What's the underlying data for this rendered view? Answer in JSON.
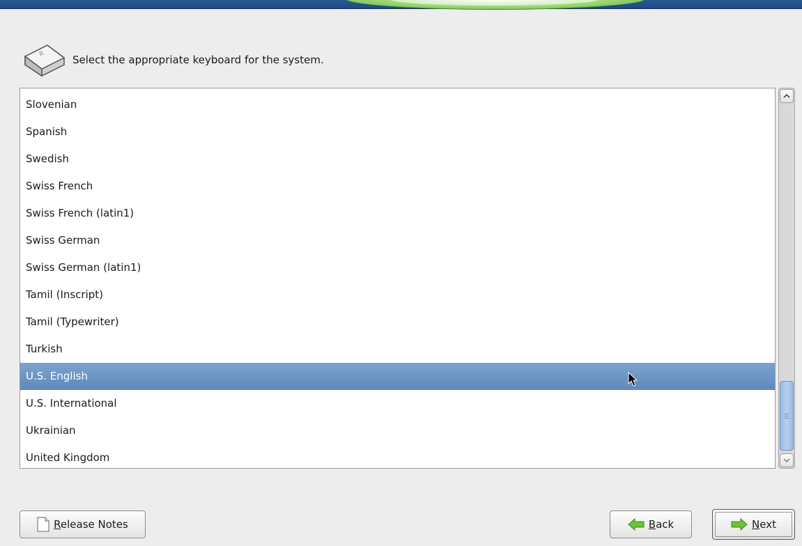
{
  "header": {
    "icon": "keyboard-key-icon",
    "prompt": "Select the appropriate keyboard for the system."
  },
  "keyboard_list": {
    "items": [
      "Slovenian",
      "Spanish",
      "Swedish",
      "Swiss French",
      "Swiss French (latin1)",
      "Swiss German",
      "Swiss German (latin1)",
      "Tamil (Inscript)",
      "Tamil (Typewriter)",
      "Turkish",
      "U.S. English",
      "U.S. International",
      "Ukrainian",
      "United Kingdom"
    ],
    "selected": "U.S. English",
    "selection_color": "#6a93c4"
  },
  "buttons": {
    "release_notes": {
      "label_first": "R",
      "label_rest": "elease Notes",
      "icon": "document-icon"
    },
    "back": {
      "label_first": "B",
      "label_rest": "ack",
      "icon": "arrow-left-icon"
    },
    "next": {
      "label_first": "N",
      "label_rest": "ext",
      "icon": "arrow-right-icon"
    }
  },
  "colors": {
    "banner": "#1f4880",
    "accent_green": "#5aa836",
    "background": "#ededed"
  }
}
